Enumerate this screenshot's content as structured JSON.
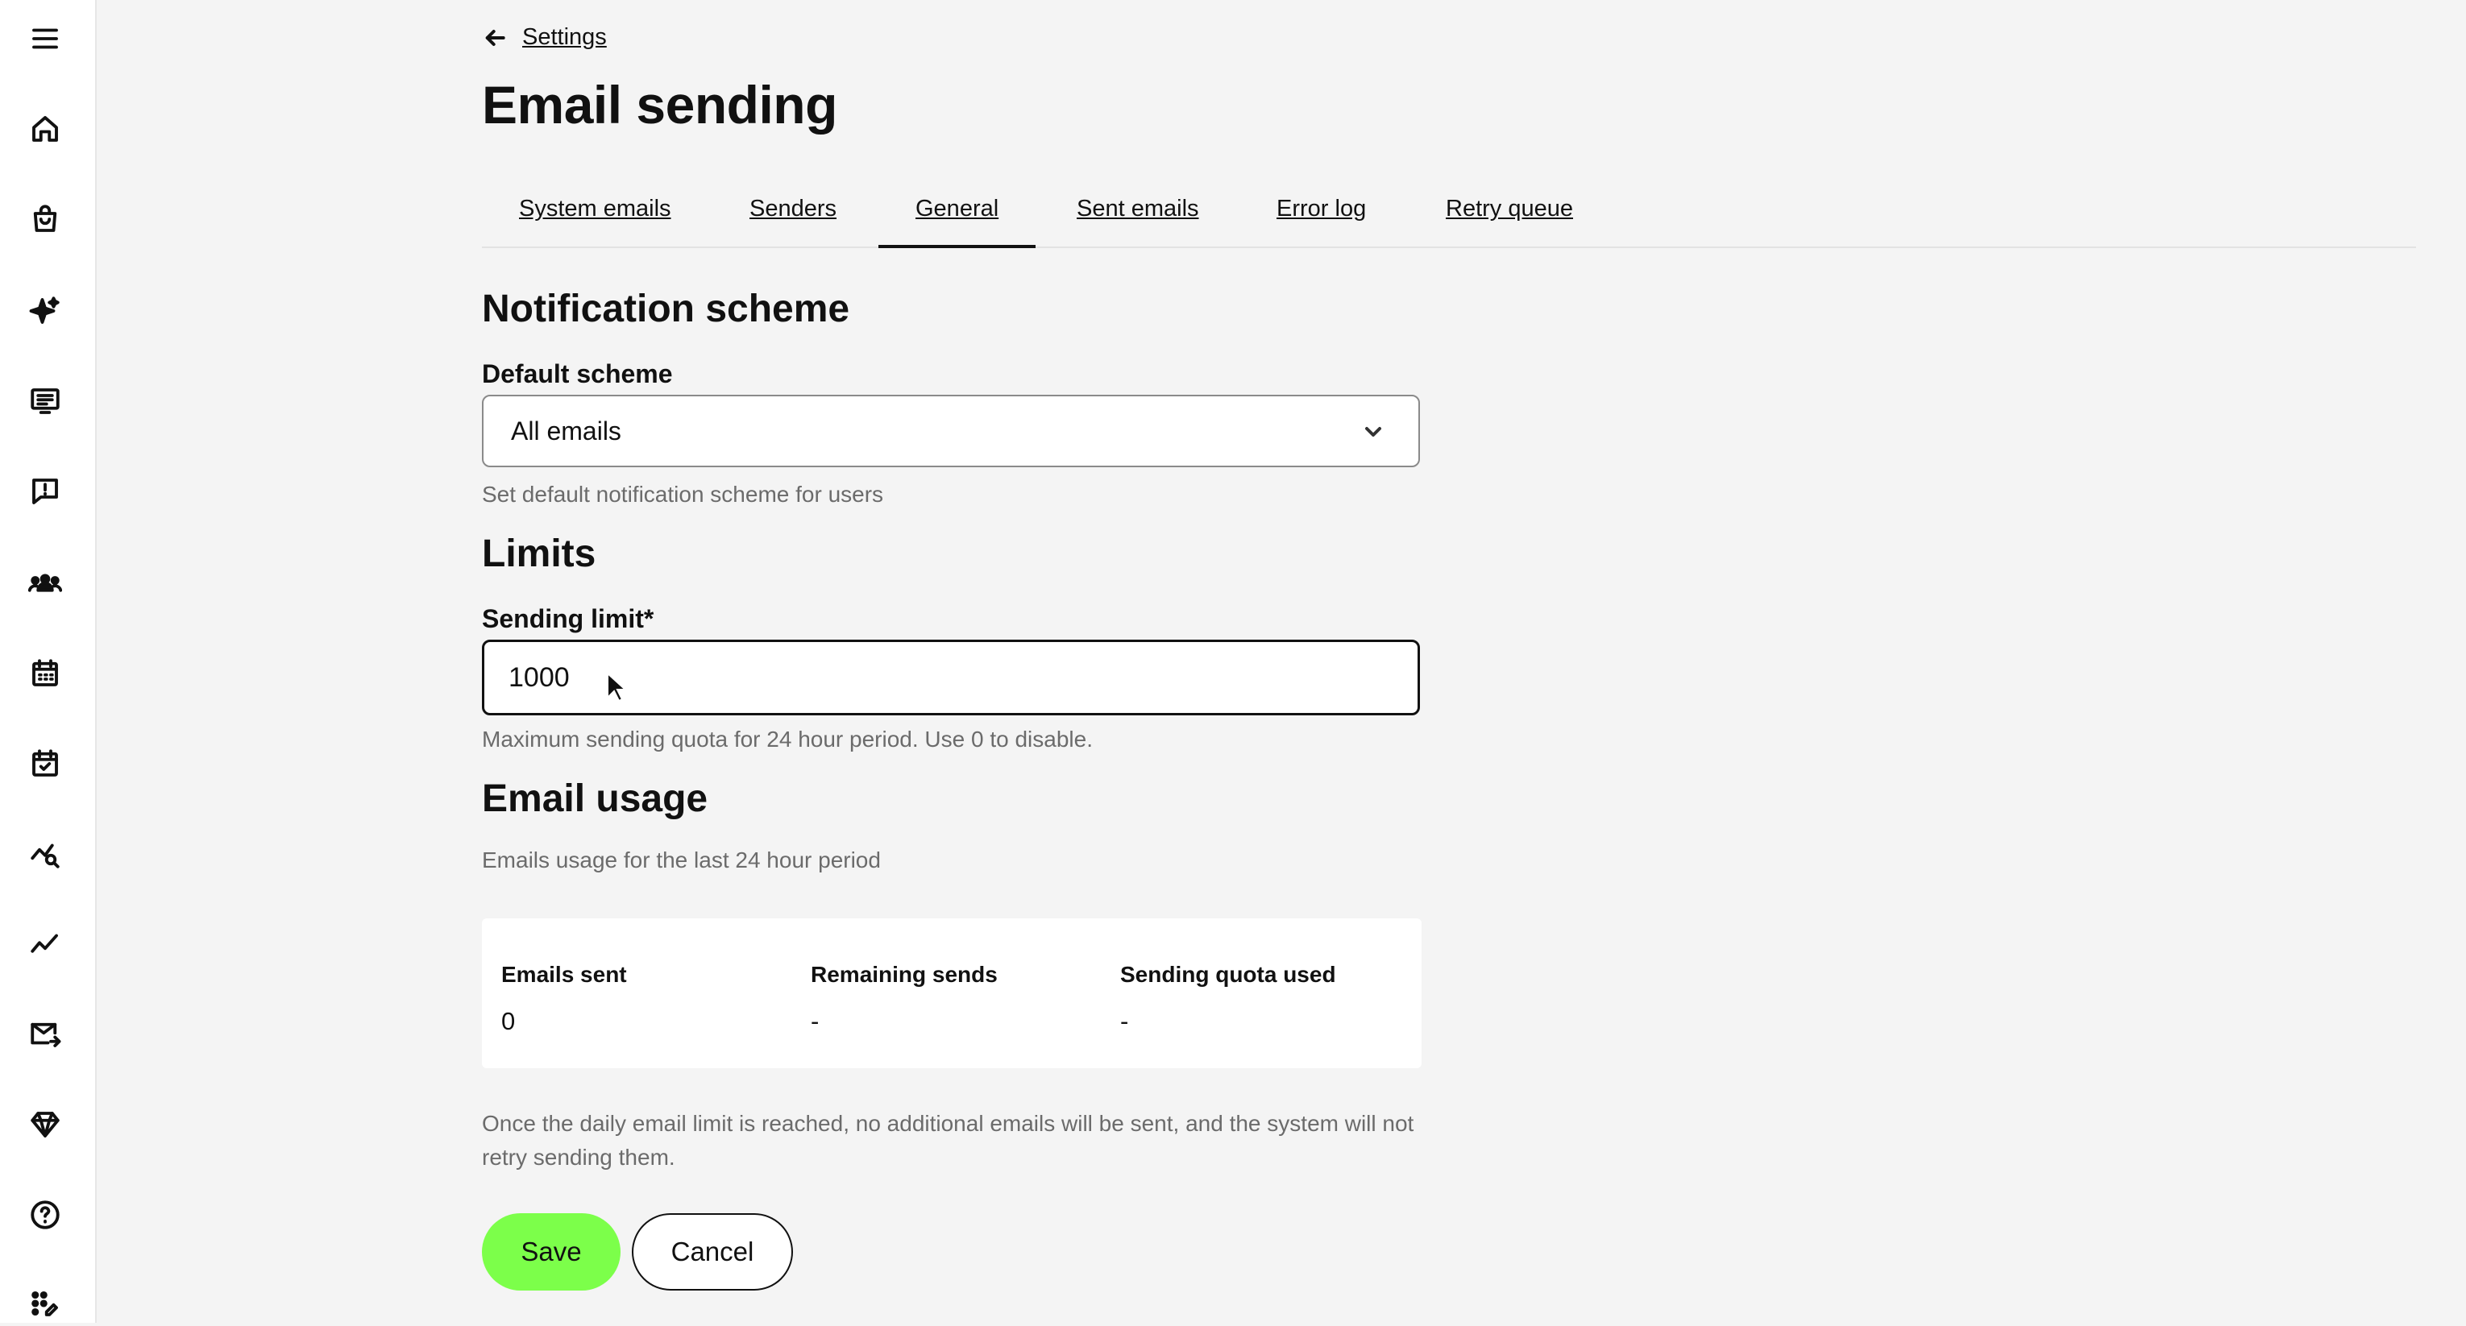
{
  "sidebar": {
    "icons": [
      "menu-icon",
      "home-icon",
      "shopping-bag-icon",
      "sparkles-icon",
      "message-list-icon",
      "alert-message-icon",
      "users-icon",
      "calendar-icon",
      "calendar-check-icon",
      "chart-search-icon",
      "trend-line-icon",
      "mail-send-icon",
      "gem-icon",
      "help-icon",
      "apps-grid-icon"
    ]
  },
  "breadcrumb": {
    "back_label": "Settings"
  },
  "page": {
    "title": "Email sending"
  },
  "tabs": [
    {
      "label": "System emails",
      "active": false
    },
    {
      "label": "Senders",
      "active": false
    },
    {
      "label": "General",
      "active": true
    },
    {
      "label": "Sent emails",
      "active": false
    },
    {
      "label": "Error log",
      "active": false
    },
    {
      "label": "Retry queue",
      "active": false
    }
  ],
  "notification": {
    "heading": "Notification scheme",
    "label": "Default scheme",
    "selected": "All emails",
    "hint": "Set default notification scheme for users"
  },
  "limits": {
    "heading": "Limits",
    "label": "Sending limit",
    "required_mark": "*",
    "value": "1000",
    "hint": "Maximum sending quota for 24 hour period. Use 0 to disable."
  },
  "usage": {
    "heading": "Email usage",
    "subtitle": "Emails usage for the last 24 hour period",
    "stats": [
      {
        "label": "Emails sent",
        "value": "0"
      },
      {
        "label": "Remaining sends",
        "value": "-"
      },
      {
        "label": "Sending quota used",
        "value": "-"
      }
    ],
    "note": "Once the daily email limit is reached, no additional emails will be sent, and the system will not retry sending them."
  },
  "actions": {
    "save": "Save",
    "cancel": "Cancel"
  },
  "colors": {
    "accent": "#7cff4a",
    "background": "#f4f4f4"
  }
}
